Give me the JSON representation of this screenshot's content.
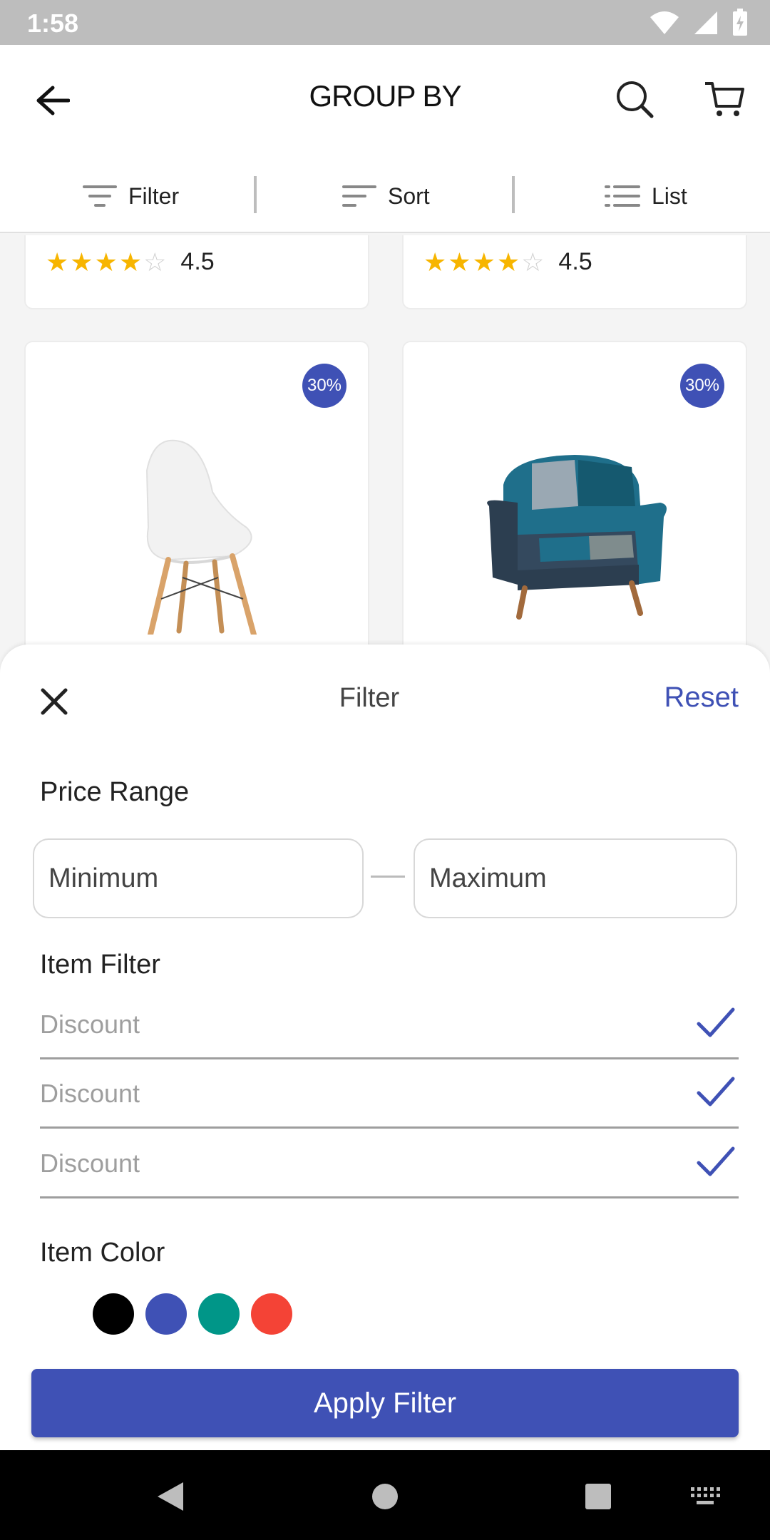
{
  "status_bar": {
    "time": "1:58"
  },
  "app_bar": {
    "title": "GROUP BY"
  },
  "toolbar": {
    "filter_label": "Filter",
    "sort_label": "Sort",
    "list_label": "List"
  },
  "products_top": [
    {
      "rating": "4.5",
      "stars": 4
    },
    {
      "rating": "4.5",
      "stars": 4
    }
  ],
  "products": [
    {
      "discount": "30%",
      "image": "white-chair"
    },
    {
      "discount": "30%",
      "image": "patchwork-armchair"
    }
  ],
  "filter_sheet": {
    "title": "Filter",
    "reset_label": "Reset",
    "price_range_label": "Price Range",
    "min_placeholder": "Minimum",
    "max_placeholder": "Maximum",
    "item_filter_label": "Item Filter",
    "item_filters": [
      {
        "label": "Discount",
        "checked": true
      },
      {
        "label": "Discount",
        "checked": true
      },
      {
        "label": "Discount",
        "checked": true
      }
    ],
    "item_color_label": "Item Color",
    "colors": [
      "#000000",
      "#3f51b5",
      "#009688",
      "#f44336"
    ],
    "apply_label": "Apply Filter"
  },
  "theme": {
    "accent": "#3f51b5",
    "star": "#f7b500"
  }
}
